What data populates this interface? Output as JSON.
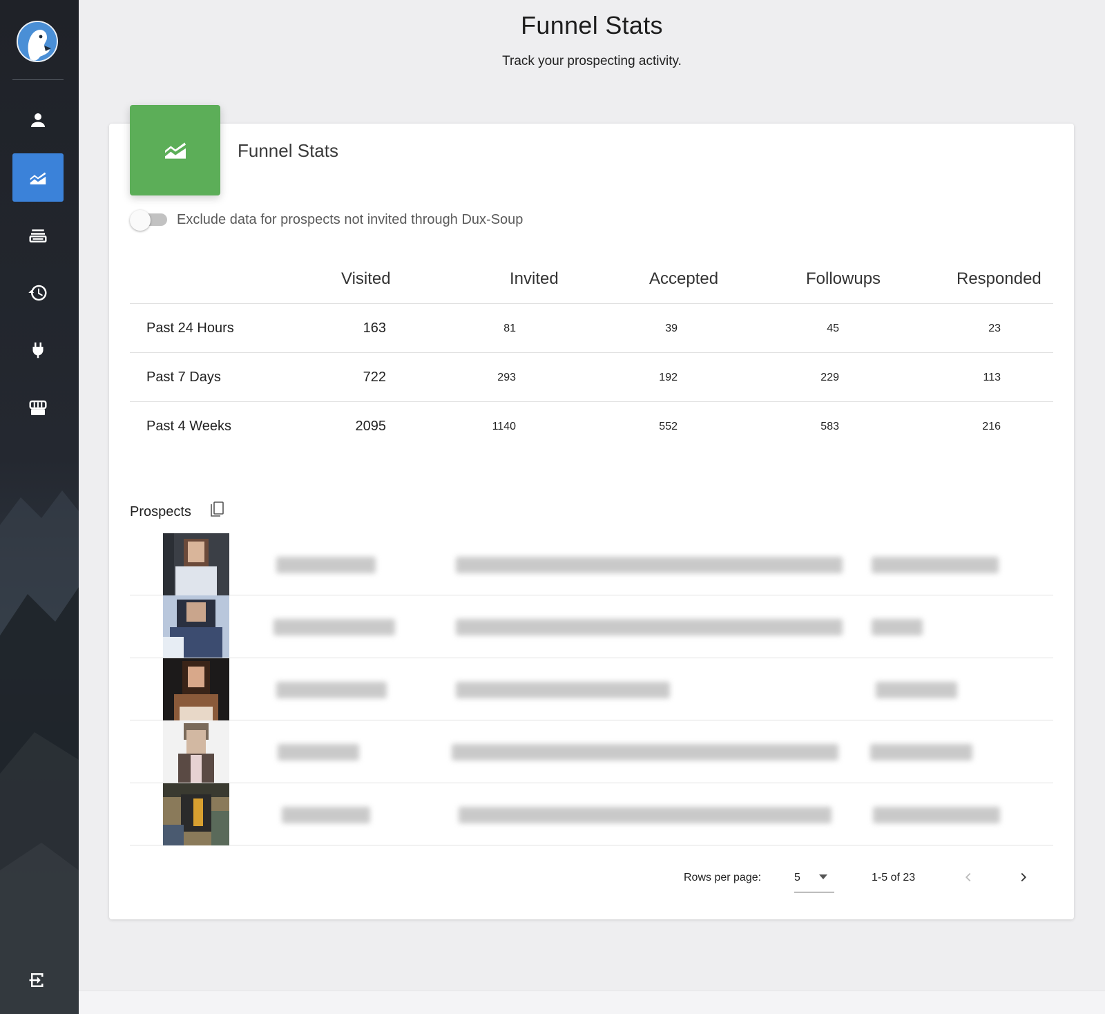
{
  "sidebar": {
    "logo": "dux-soup-duck-logo",
    "items": [
      {
        "icon": "person-icon",
        "active": false
      },
      {
        "icon": "funnel-stats-chart-icon",
        "active": true
      },
      {
        "icon": "queue-list-icon",
        "active": false
      },
      {
        "icon": "history-icon",
        "active": false
      },
      {
        "icon": "plug-icon",
        "active": false
      },
      {
        "icon": "store-icon",
        "active": false
      }
    ],
    "logout_icon": "logout-icon"
  },
  "header": {
    "title": "Funnel Stats",
    "subtitle": "Track your prospecting activity."
  },
  "card": {
    "title": "Funnel Stats",
    "icon": "area-chart-icon",
    "accent_color": "#5cae58",
    "toggle": {
      "label": "Exclude data for prospects not invited through Dux-Soup",
      "checked": false
    }
  },
  "stats": {
    "columns": [
      "Visited",
      "Invited",
      "Accepted",
      "Followups",
      "Responded"
    ],
    "rows": [
      {
        "label": "Past 24 Hours",
        "values": [
          "163",
          "81",
          "39",
          "45",
          "23"
        ]
      },
      {
        "label": "Past 7 Days",
        "values": [
          "722",
          "293",
          "192",
          "229",
          "113"
        ]
      },
      {
        "label": "Past 4 Weeks",
        "values": [
          "2095",
          "1140",
          "552",
          "583",
          "216"
        ]
      }
    ]
  },
  "prospects": {
    "title": "Prospects",
    "copy_icon": "copy-icon",
    "row_count_visible": 5
  },
  "pagination": {
    "rows_per_page_label": "Rows per page:",
    "rows_per_page_value": "5",
    "range_label": "1-5 of 23"
  },
  "colors": {
    "sidebar_active": "#3b82d9",
    "page_bg": "#eeeef0"
  }
}
